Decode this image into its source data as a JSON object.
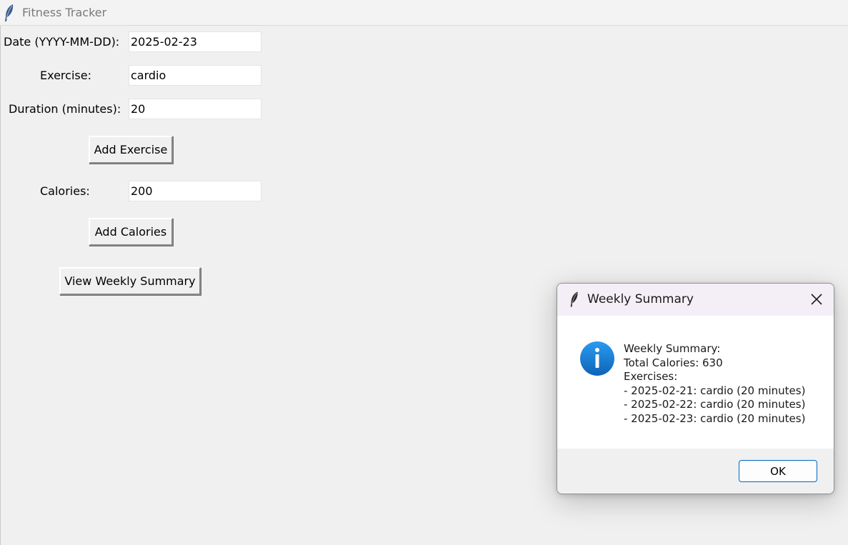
{
  "window": {
    "title": "Fitness Tracker"
  },
  "form": {
    "date_label": "Date (YYYY-MM-DD):",
    "date_value": "2025-02-23",
    "exercise_label": "Exercise:",
    "exercise_value": "cardio",
    "duration_label": "Duration (minutes):",
    "duration_value": "20",
    "add_exercise_label": "Add Exercise",
    "calories_label": "Calories:",
    "calories_value": "200",
    "add_calories_label": "Add Calories",
    "view_summary_label": "View Weekly Summary"
  },
  "dialog": {
    "title": "Weekly Summary",
    "message_lines": [
      "Weekly Summary:",
      "Total Calories: 630",
      "Exercises:",
      "- 2025-02-21: cardio (20 minutes)",
      "- 2025-02-22: cardio (20 minutes)",
      "- 2025-02-23: cardio (20 minutes)"
    ],
    "ok_label": "OK"
  },
  "colors": {
    "accent": "#0067c0",
    "info_icon": "#1a7fd4",
    "window_bg": "#f0f0f0",
    "dialog_title_bg": "#f4eff6"
  },
  "icons": {
    "app": "feather-icon",
    "dialog_app": "feather-icon",
    "close": "close-icon",
    "info": "info-icon"
  }
}
